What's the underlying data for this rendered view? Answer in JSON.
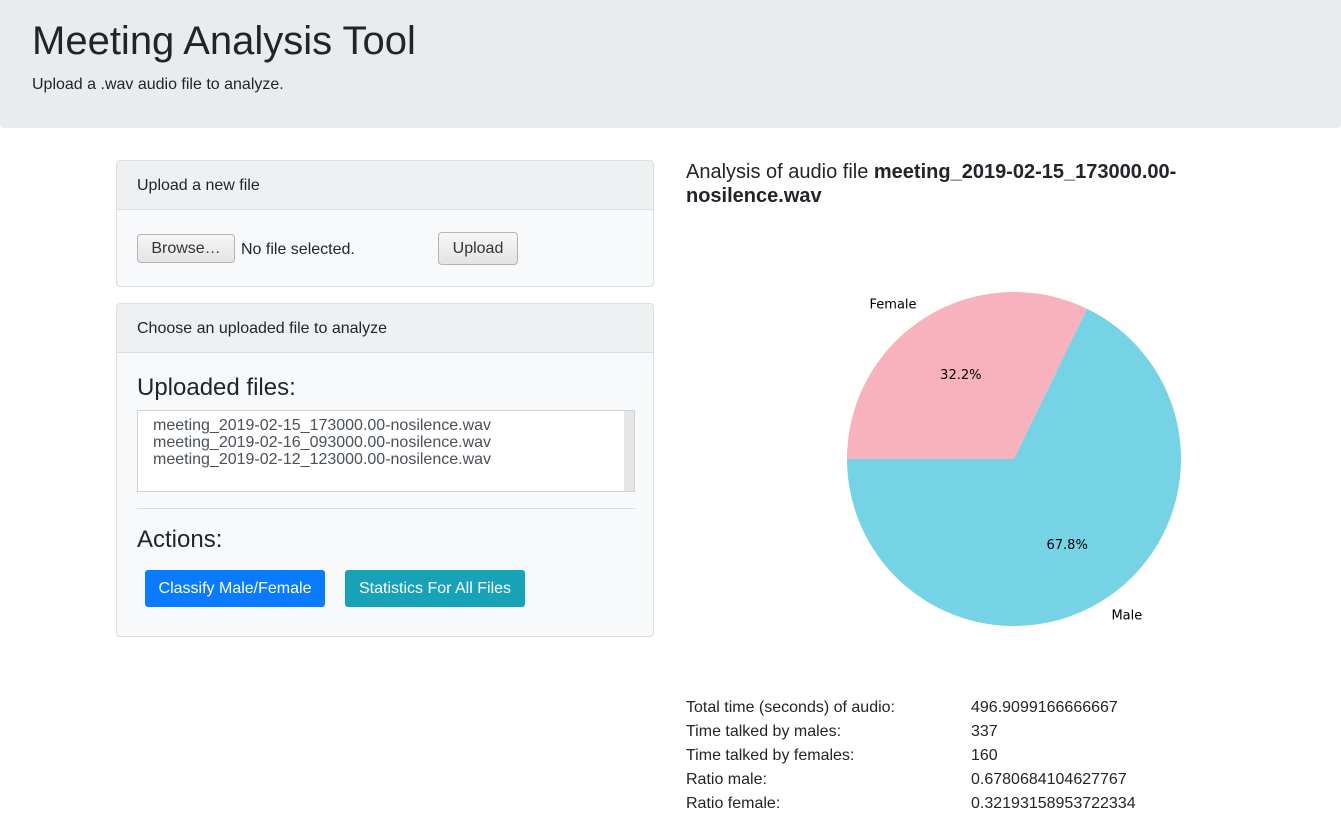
{
  "header": {
    "title": "Meeting Analysis Tool",
    "subtitle": "Upload a .wav audio file to analyze."
  },
  "upload_card": {
    "header": "Upload a new file",
    "browse_label": "Browse…",
    "file_status": "No file selected.",
    "upload_label": "Upload"
  },
  "choose_card": {
    "header": "Choose an uploaded file to analyze",
    "files_title": "Uploaded files:",
    "files": [
      "meeting_2019-02-15_173000.00-nosilence.wav",
      "meeting_2019-02-16_093000.00-nosilence.wav",
      "meeting_2019-02-12_123000.00-nosilence.wav"
    ],
    "actions_title": "Actions:",
    "classify_label": "Classify Male/Female",
    "stats_label": "Statistics For All Files"
  },
  "analysis": {
    "prefix": "Analysis of audio file ",
    "filename": "meeting_2019-02-15_173000.00-nosilence.wav"
  },
  "chart_data": {
    "type": "pie",
    "categories": [
      "Female",
      "Male"
    ],
    "values": [
      32.2,
      67.8
    ],
    "value_labels": [
      "32.2%",
      "67.8%"
    ],
    "colors": [
      "#f8b2be",
      "#76d2e5"
    ],
    "start_angle_deg": 180,
    "direction": "clockwise"
  },
  "stats": [
    {
      "label": "Total time (seconds) of audio:",
      "value": "496.9099166666667"
    },
    {
      "label": "Time talked by males:",
      "value": "337"
    },
    {
      "label": "Time talked by females:",
      "value": "160"
    },
    {
      "label": "Ratio male:",
      "value": "0.6780684104627767"
    },
    {
      "label": "Ratio female:",
      "value": "0.32193158953722334"
    }
  ]
}
